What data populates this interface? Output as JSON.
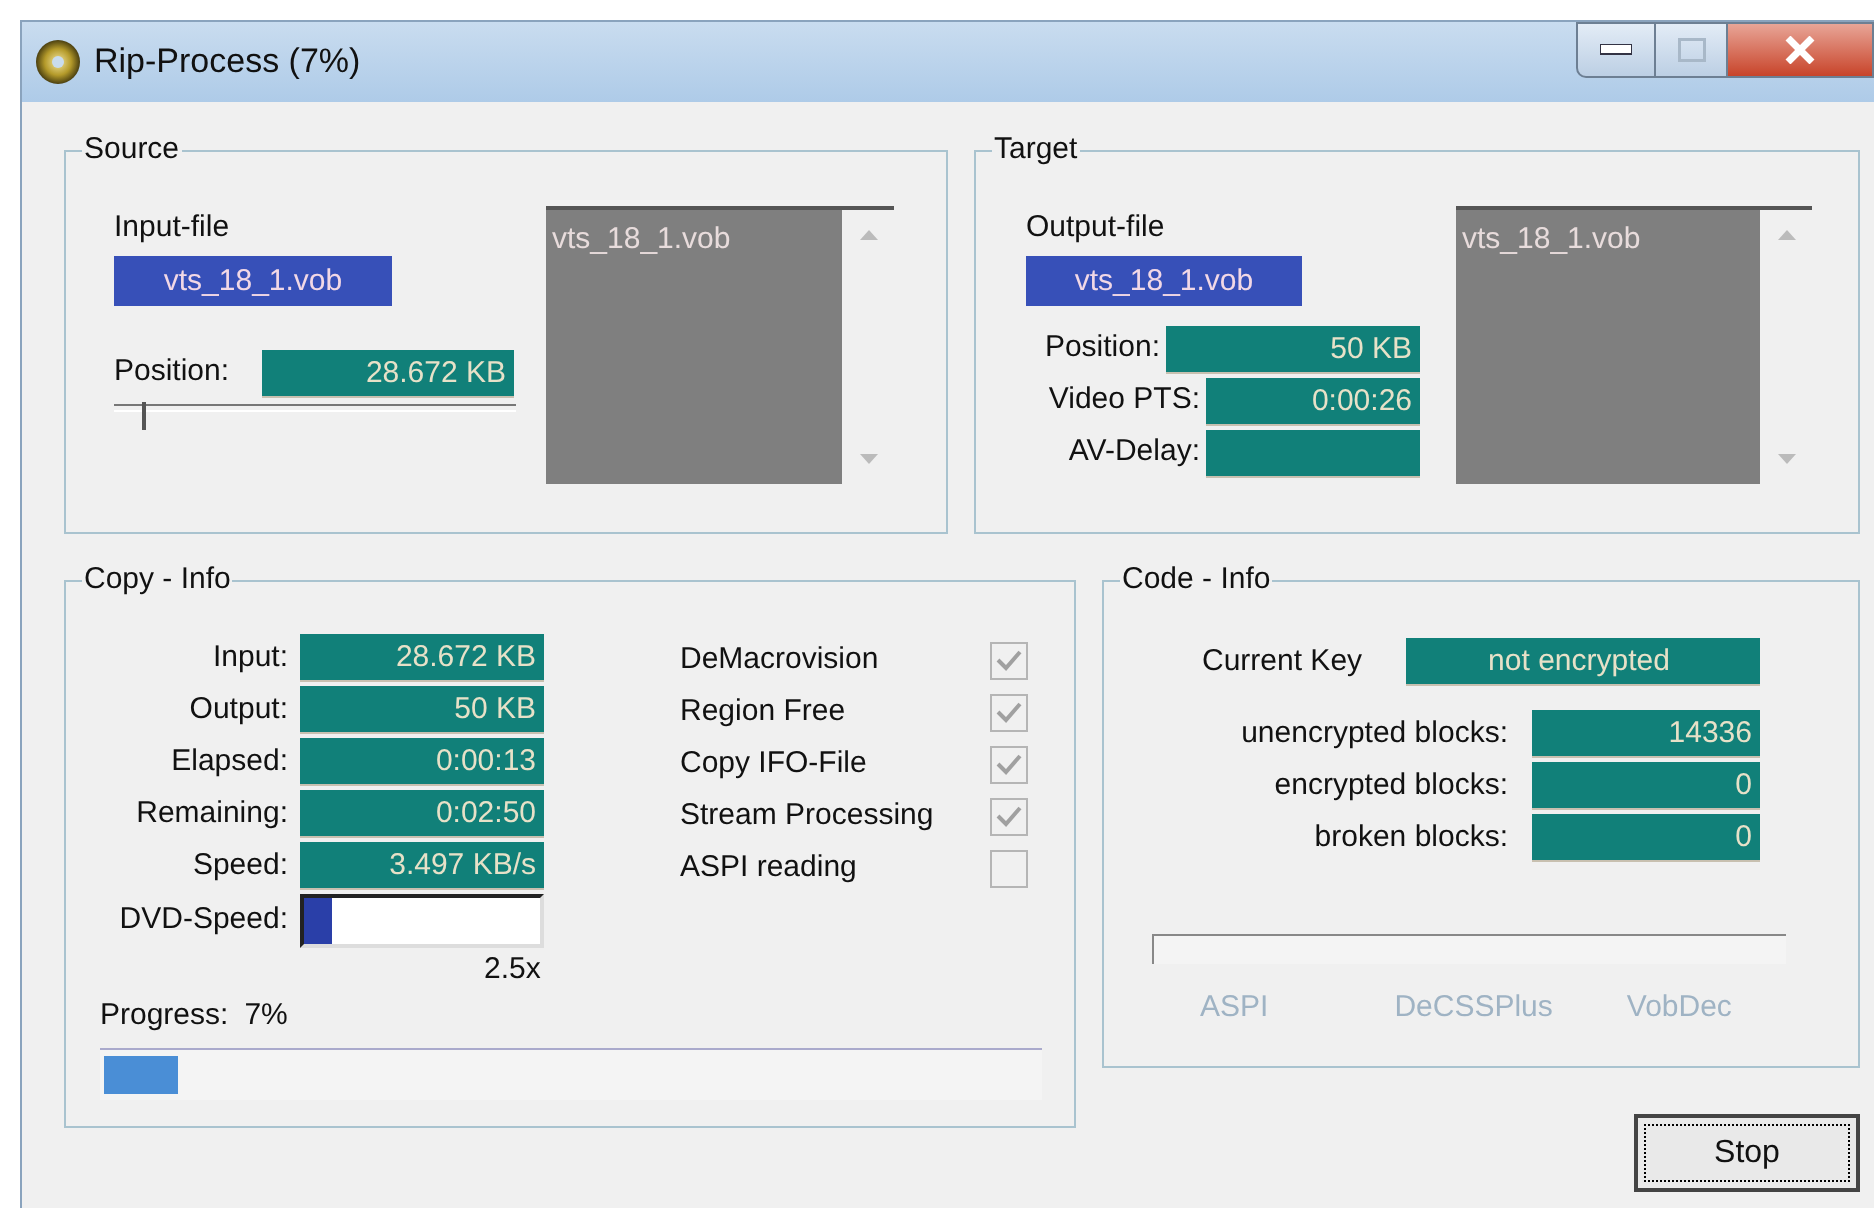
{
  "window": {
    "title": "Rip-Process (7%)"
  },
  "source": {
    "title": "Source",
    "input_file_label": "Input-file",
    "input_file": "vts_18_1.vob",
    "position_label": "Position:",
    "position": "28.672 KB",
    "slider": {
      "level": 0.07
    },
    "file_list": [
      "vts_18_1.vob"
    ]
  },
  "target": {
    "title": "Target",
    "output_file_label": "Output-file",
    "output_file": "vts_18_1.vob",
    "fields": [
      {
        "label": "Position:",
        "value": "50 KB"
      },
      {
        "label": "Video PTS:",
        "value": "0:00:26"
      },
      {
        "label": "AV-Delay:"
      }
    ],
    "file_list": [
      "vts_18_1.vob"
    ]
  },
  "copy_info": {
    "title": "Copy - Info",
    "fields": [
      {
        "label": "Input:",
        "value": "28.672 KB"
      },
      {
        "label": "Output:",
        "value": "50 KB"
      },
      {
        "label": "Elapsed:",
        "value": "0:00:13"
      },
      {
        "label": "Remaining:",
        "value": "0:02:50"
      },
      {
        "label": "Speed:",
        "value": "3.497 KB/s"
      }
    ],
    "dvd_speed": {
      "label": "DVD-Speed:",
      "level": 0.12,
      "reading": "2.5x"
    },
    "options": [
      {
        "label": "DeMacrovision",
        "checked": true,
        "disabled": true
      },
      {
        "label": "Region Free",
        "checked": true,
        "disabled": true
      },
      {
        "label": "Copy IFO-File",
        "checked": true,
        "disabled": true
      },
      {
        "label": "Stream Processing",
        "checked": true,
        "disabled": true
      },
      {
        "label": "ASPI reading",
        "checked": false,
        "disabled": true
      }
    ],
    "progress": {
      "label": "Progress:",
      "reading": "7%",
      "level": 0.08
    }
  },
  "code_info": {
    "title": "Code - Info",
    "current_key_label": "Current Key",
    "current_key": "not encrypted",
    "blocks": [
      {
        "label": "unencrypted blocks:",
        "value": "14336"
      },
      {
        "label": "encrypted blocks:",
        "value": "0"
      },
      {
        "label": "broken blocks:",
        "value": "0"
      }
    ],
    "progress": {
      "level": 0
    },
    "methods": [
      {
        "label": "ASPI",
        "disabled": true
      },
      {
        "label": "DeCSSPlus",
        "disabled": true
      },
      {
        "label": "VobDec",
        "disabled": true
      }
    ]
  },
  "buttons": [
    {
      "label": "Stop",
      "focused": true
    }
  ]
}
